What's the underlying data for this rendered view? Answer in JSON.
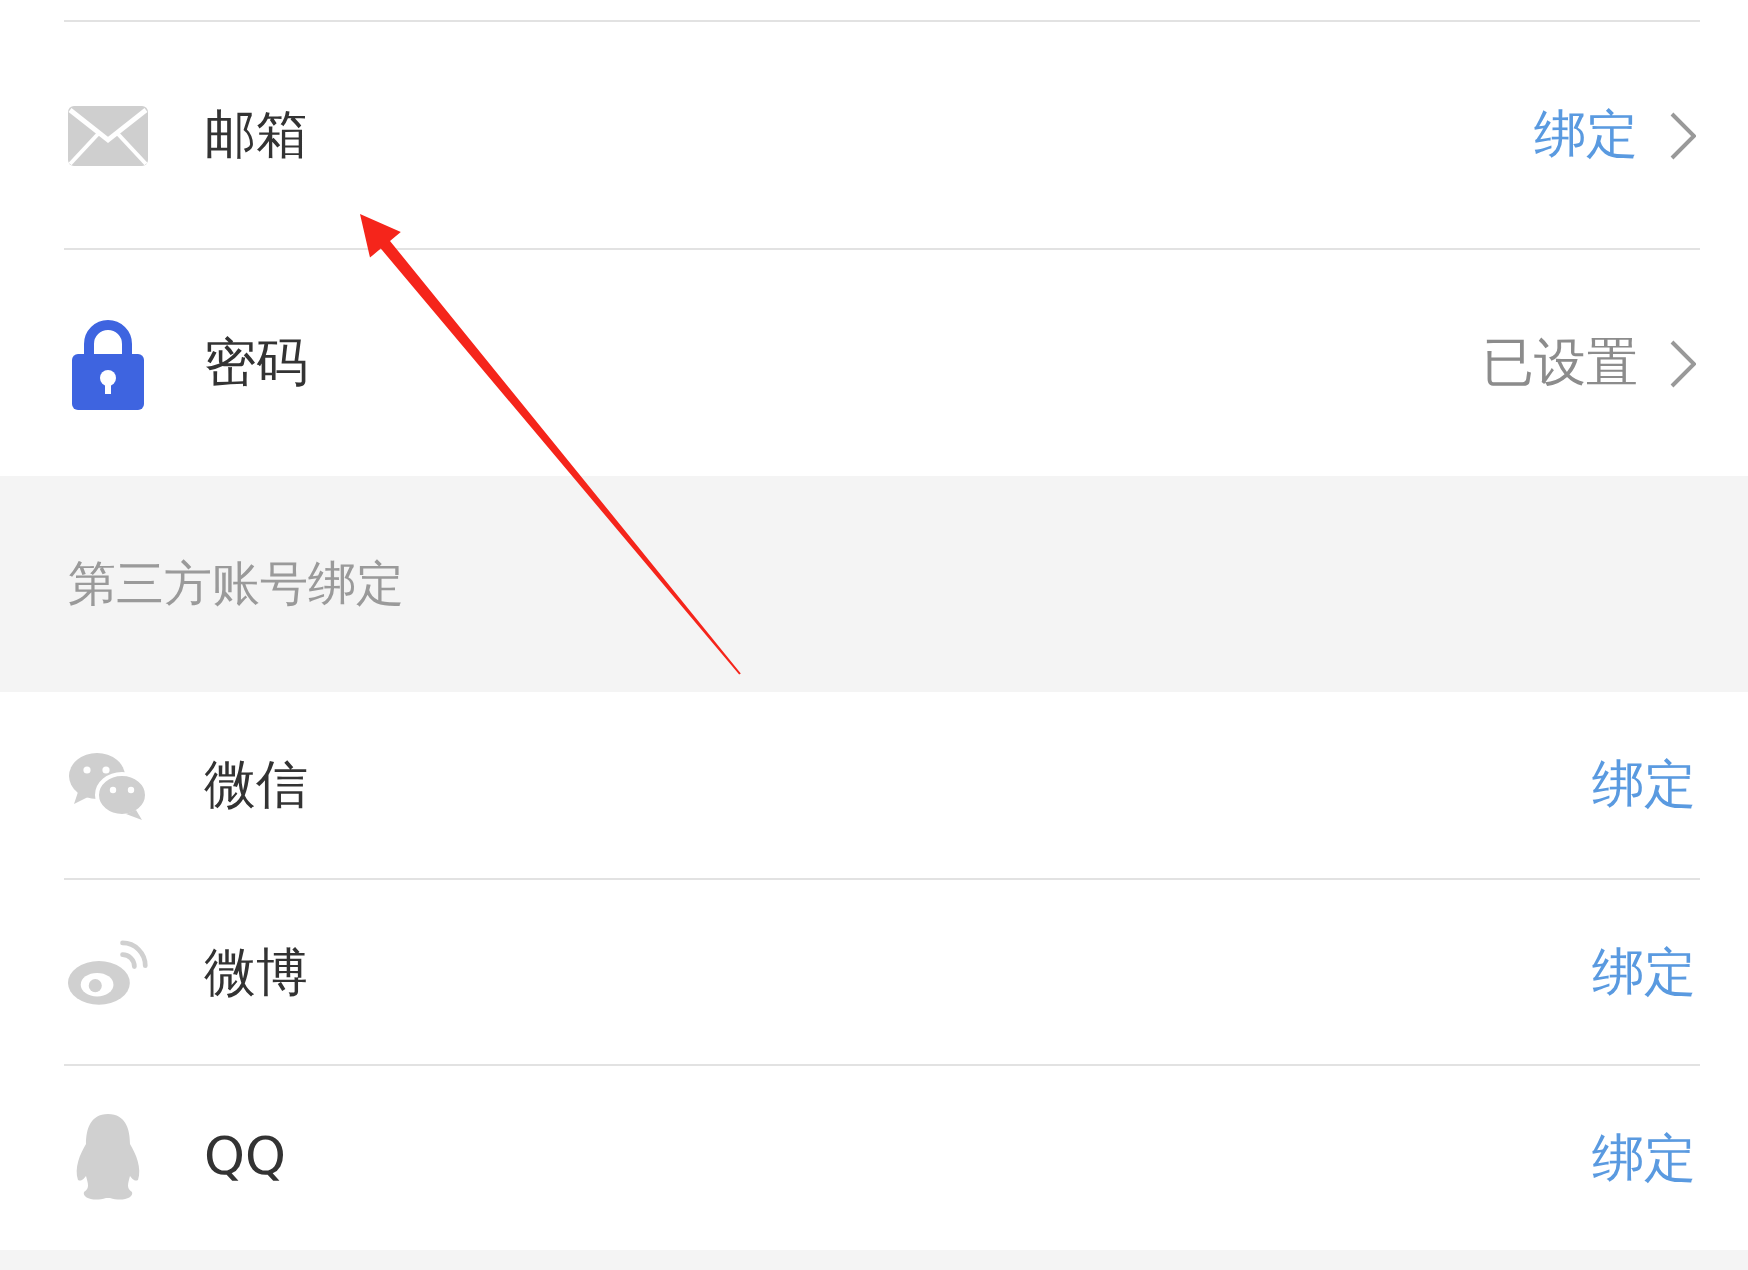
{
  "sections": [
    {
      "rows": [
        {
          "kind": "mail",
          "label": "邮箱",
          "value": "绑定",
          "value_link": true,
          "chevron": true
        },
        {
          "kind": "lock",
          "label": "密码",
          "value": "已设置",
          "value_link": false,
          "chevron": true
        }
      ]
    },
    {
      "header": "第三方账号绑定",
      "rows": [
        {
          "kind": "chat",
          "label": "微信",
          "value": "绑定",
          "value_link": true,
          "chevron": false
        },
        {
          "kind": "eye",
          "label": "微博",
          "value": "绑定",
          "value_link": true,
          "chevron": false
        },
        {
          "kind": "penguin",
          "label": "QQ",
          "value": "绑定",
          "value_link": true,
          "chevron": false
        }
      ]
    }
  ]
}
